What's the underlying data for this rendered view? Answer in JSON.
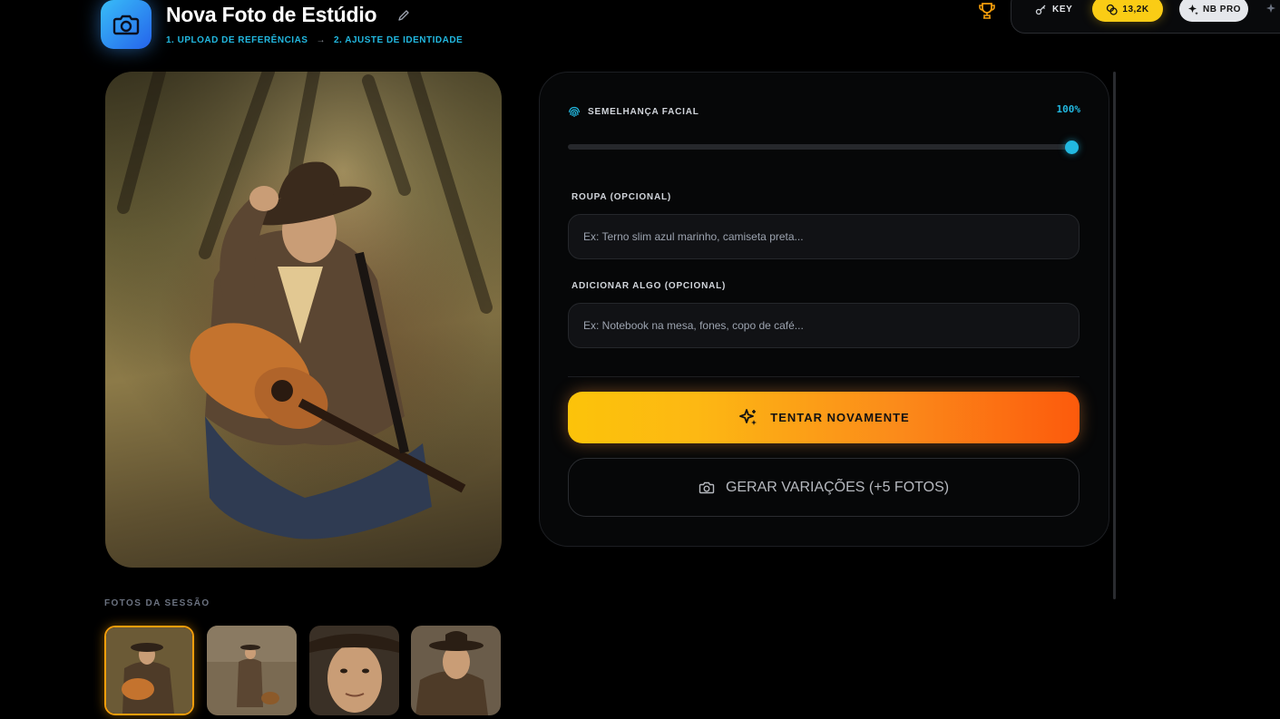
{
  "header": {
    "title": "Nova Foto de Estúdio",
    "step1": "1. UPLOAD DE REFERÊNCIAS",
    "step_arrow": "→",
    "step2": "2. AJUSTE DE IDENTIDADE",
    "key_label": "KEY",
    "credits": "13,2K",
    "model": "NB PRO"
  },
  "session": {
    "label": "FOTOS DA SESSÃO"
  },
  "panel": {
    "similarity_label": "SEMELHANÇA FACIAL",
    "similarity_value": "100%",
    "similarity_level": 1.0,
    "outfit_label": "ROUPA (OPCIONAL)",
    "outfit_placeholder": "Ex: Terno slim azul marinho, camiseta preta...",
    "addon_label": "ADICIONAR ALGO (OPCIONAL)",
    "addon_placeholder": "Ex: Notebook na mesa, fones, copo de café...",
    "retry_label": "TENTAR NOVAMENTE",
    "variations_label": "GERAR VARIAÇÕES (+5 FOTOS)"
  },
  "colors": {
    "accent": "#22b8e0",
    "credits_bg": "#facc15",
    "retry_from": "#fcc30a",
    "retry_to": "#fc5a0c",
    "selected_border": "#f59e0b"
  },
  "icons": {
    "app": "camera-icon",
    "edit": "pencil-icon",
    "trophy": "trophy-icon",
    "key": "key-icon",
    "credits": "coins-icon",
    "model": "sparkles-icon",
    "similarity": "fingerprint-icon",
    "retry": "sparkles-icon",
    "variations": "camera-icon"
  }
}
